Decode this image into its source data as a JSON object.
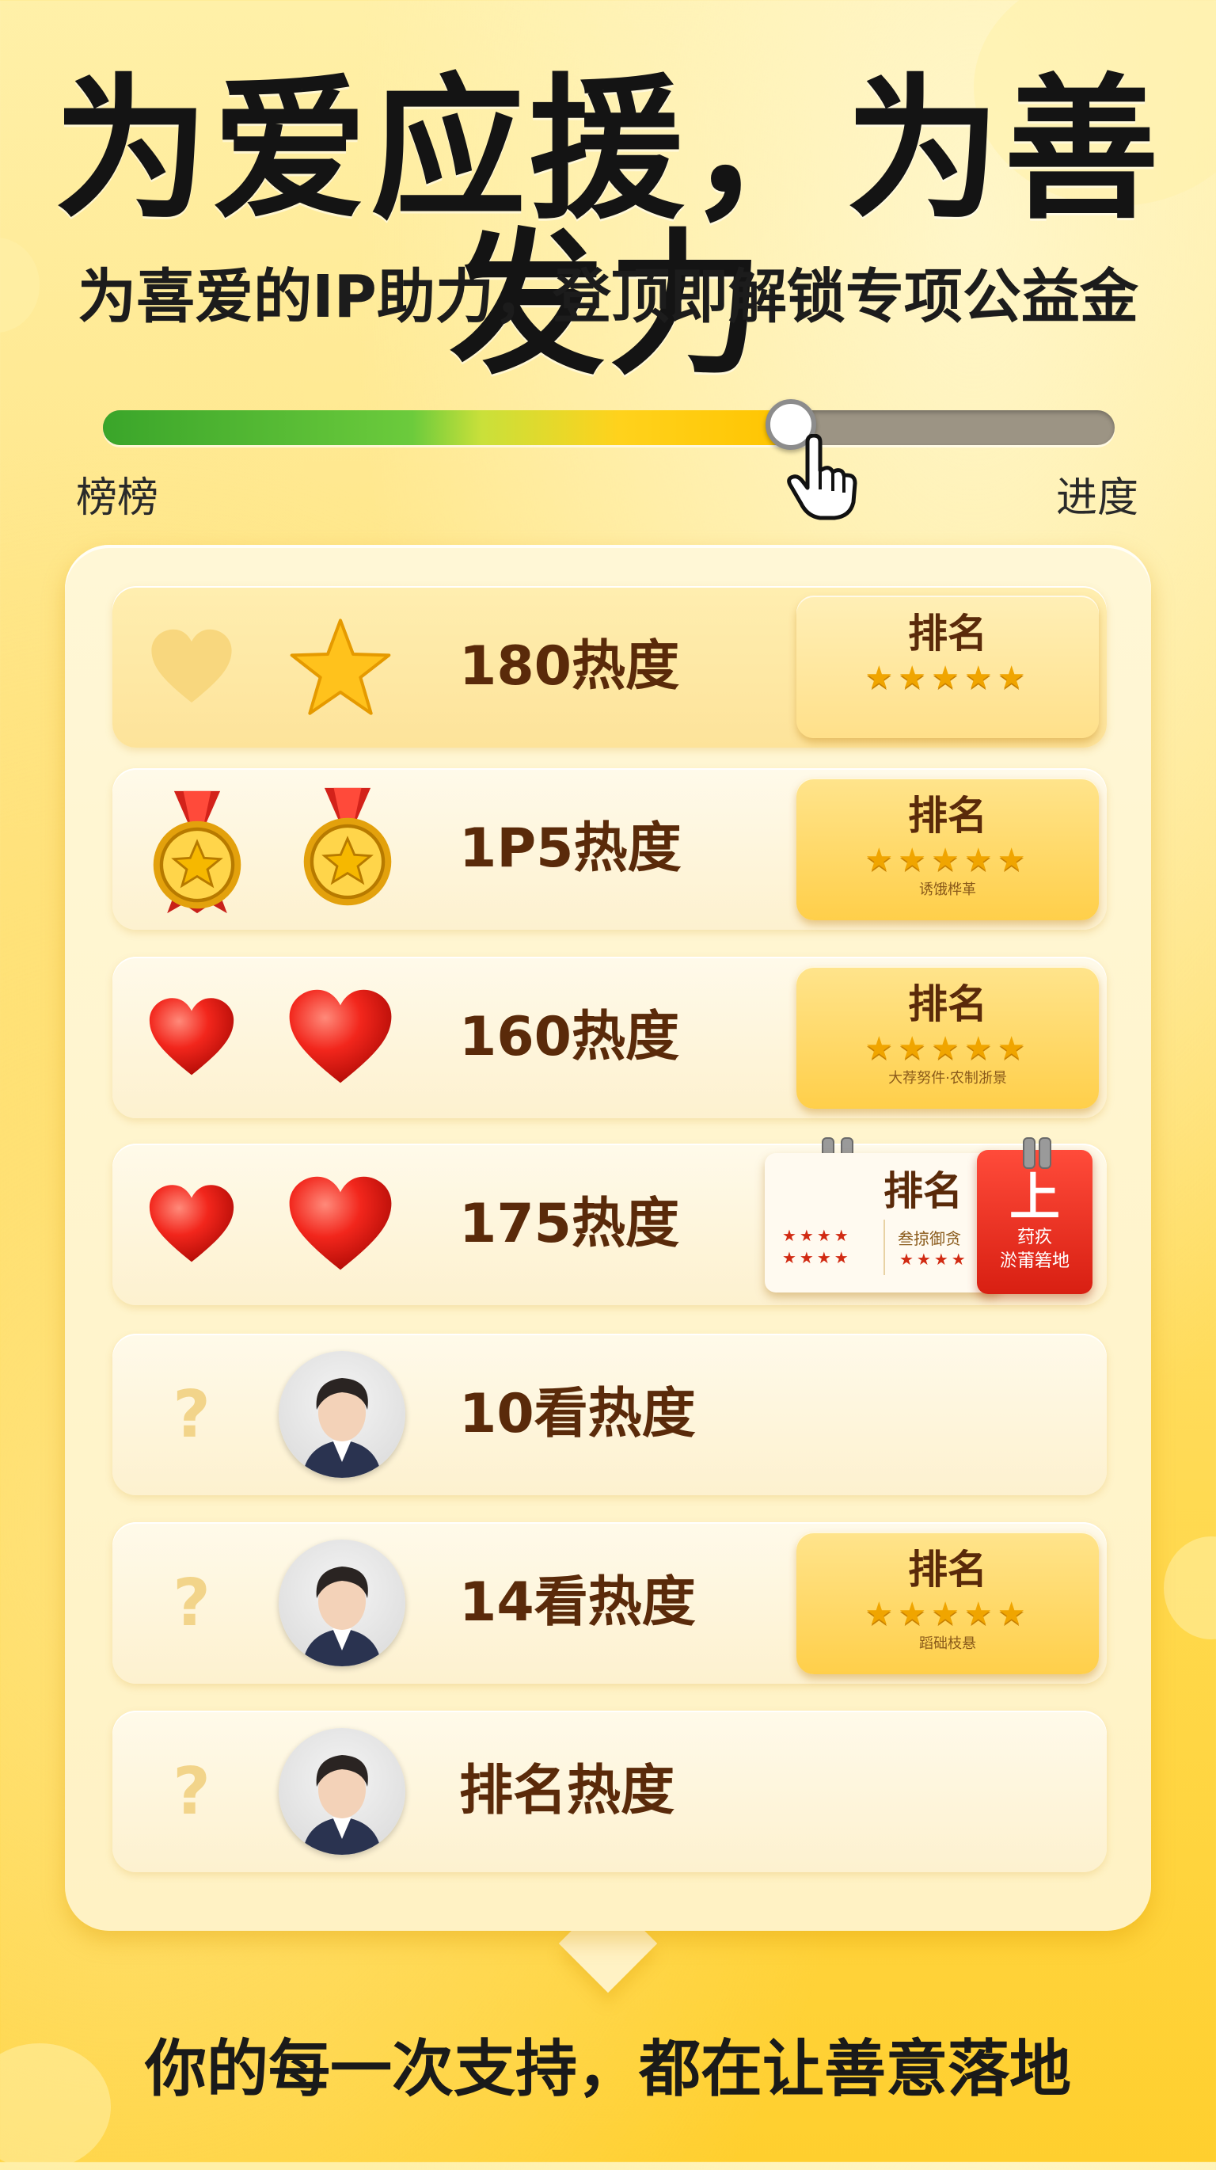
{
  "header": {
    "title": "为爱应援，为善发力",
    "subtitle": "为喜爱的IP助力，登顶即解锁专项公益金"
  },
  "progress": {
    "left_label": "榜榜",
    "right_label": "进度",
    "value": 0.68
  },
  "rows": [
    {
      "icons": [
        "heart-outline-icon",
        "star-icon"
      ],
      "label": "180热度",
      "badge": {
        "title": "排名",
        "stars": "★★★★★",
        "caption": ""
      }
    },
    {
      "icons": [
        "medal-icon",
        "medal-icon"
      ],
      "label": "1P5热度",
      "badge": {
        "title": "排名",
        "stars": "★★★★★",
        "caption": "诱饿桦革"
      }
    },
    {
      "icons": [
        "heart-icon",
        "heart-icon"
      ],
      "label": "160热度",
      "badge": {
        "title": "排名",
        "stars": "★★★★★",
        "caption": "大荐努件·农制浙景"
      }
    },
    {
      "icons": [
        "heart-icon",
        "heart-icon"
      ],
      "label": "175热度",
      "calendar": {
        "title": "排名",
        "stars_left": "★★★★\n★★★★",
        "mid_text": "叁掠御贪",
        "stars_right": "★★★★",
        "red_big": "上",
        "red_small1": "荮疚",
        "red_small2": "淤莆箬地"
      }
    },
    {
      "icons": [
        "question-icon",
        "avatar"
      ],
      "label": "10看热度"
    },
    {
      "icons": [
        "question-icon",
        "avatar"
      ],
      "label": "14看热度",
      "badge": {
        "title": "排名",
        "stars": "★★★★★",
        "caption": "蹈础枝悬"
      }
    },
    {
      "icons": [
        "question-icon",
        "avatar"
      ],
      "label": "排名热度"
    }
  ],
  "footer": {
    "text": "你的每一次支持，都在让善意落地"
  },
  "colors": {
    "accent": "#ffcf2e",
    "progress_green": "#3aa52a",
    "progress_yellow": "#ffc400",
    "heart_red": "#e8201a",
    "label_brown": "#5a2a0a"
  }
}
